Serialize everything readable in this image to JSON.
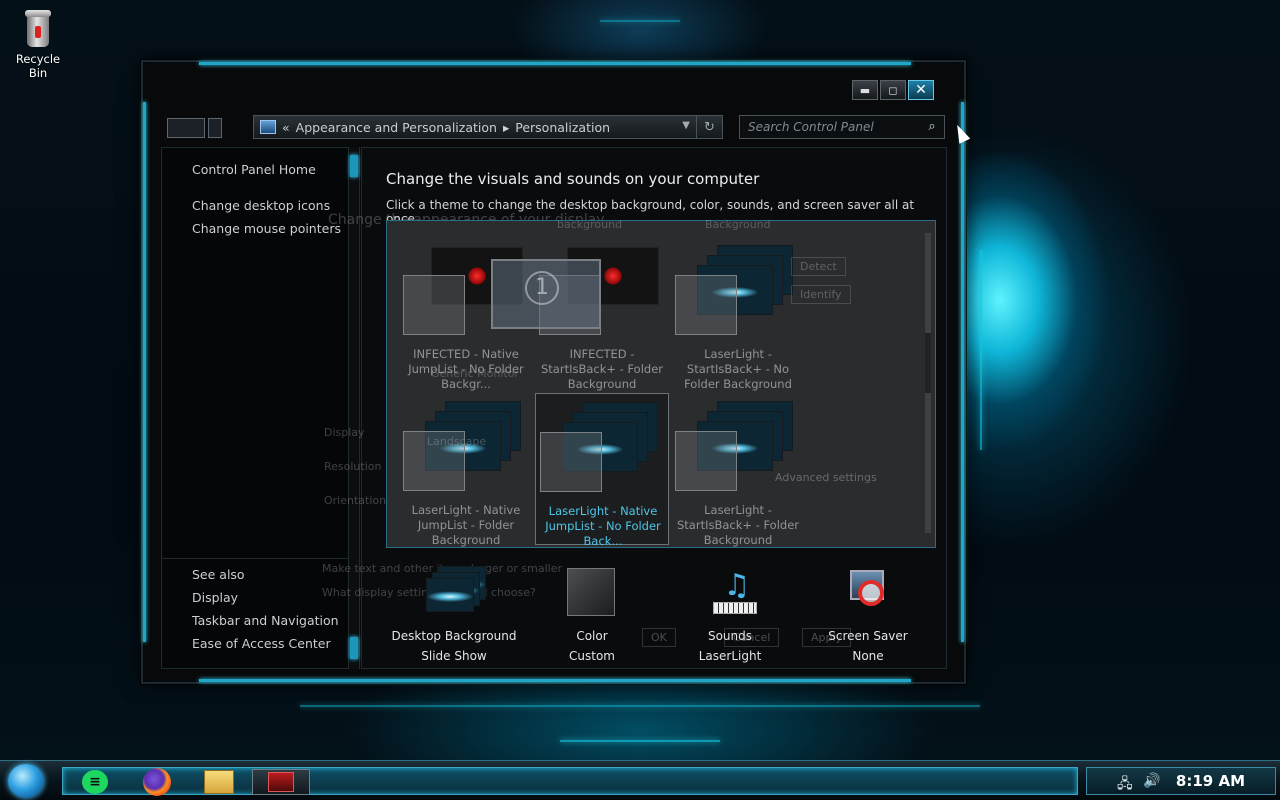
{
  "desktop": {
    "recycle_bin_label": "Recycle Bin"
  },
  "window": {
    "breadcrumb": {
      "prefix": "«",
      "parent": "Appearance and Personalization",
      "separator": "▸",
      "current": "Personalization"
    },
    "search": {
      "placeholder": "Search Control Panel"
    },
    "left_pane": {
      "home_link": "Control Panel Home",
      "links": [
        "Change desktop icons",
        "Change mouse pointers"
      ],
      "see_also_title": "See also",
      "see_also": [
        "Display",
        "Taskbar and Navigation",
        "Ease of Access Center"
      ]
    },
    "main": {
      "heading": "Change the visuals and sounds on your computer",
      "subheading": "Click a theme to change the desktop background, color, sounds, and screen saver all at once.",
      "ghost_text": "Change the appearance of your display",
      "ghost_labels": {
        "detect": "Detect",
        "identify": "Identify",
        "display": "Display",
        "resolution": "Resolution",
        "orientation": "Orientation",
        "advanced": "Advanced settings",
        "make_text": "Make text and other items larger or smaller",
        "what_settings": "What display settings should I choose?",
        "ok": "OK",
        "cancel": "Cancel",
        "apply": "Apply",
        "monitor_num": "1",
        "monitor_name": "Generic Monitor",
        "landscape": "Landscape",
        "bg_top1": "background",
        "bg_top2": "Background"
      },
      "themes": [
        {
          "name": "INFECTED - Native JumpList - No Folder Backgr...",
          "selected": false
        },
        {
          "name": "INFECTED - StartIsBack+ - Folder Background",
          "selected": false
        },
        {
          "name": "LaserLight - StartIsBack+ - No Folder Background",
          "selected": false
        },
        {
          "name": "LaserLight - Native JumpList - Folder Background",
          "selected": false
        },
        {
          "name": "LaserLight - Native JumpList - No Folder Back...",
          "selected": true
        },
        {
          "name": "LaserLight - StartIsBack+ - Folder Background",
          "selected": false
        }
      ],
      "bottom_items": [
        {
          "title": "Desktop Background",
          "value": "Slide Show",
          "icon": "desktop-background-icon"
        },
        {
          "title": "Color",
          "value": "Custom",
          "icon": "color-swatch-icon"
        },
        {
          "title": "Sounds",
          "value": "LaserLight",
          "icon": "sounds-icon"
        },
        {
          "title": "Screen Saver",
          "value": "None",
          "icon": "screen-saver-icon"
        }
      ]
    }
  },
  "taskbar": {
    "clock": "8:19 AM"
  },
  "colors": {
    "accent": "#1fb4d9",
    "selected_theme_text": "#4cc7e8"
  }
}
